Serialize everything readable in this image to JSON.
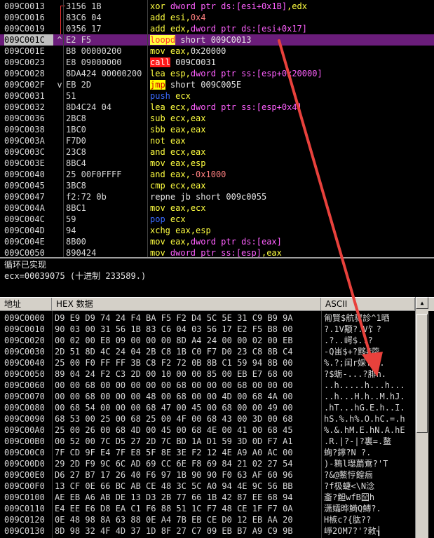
{
  "disasm": {
    "rows": [
      {
        "addr": "009C0013",
        "bytes": "3156 1B",
        "parts": [
          [
            "xor ",
            "kw"
          ],
          [
            "dword ptr ds:[esi+0x1B]",
            "mem"
          ],
          [
            ",edx",
            "kw"
          ]
        ]
      },
      {
        "addr": "009C0016",
        "bytes": "83C6 04",
        "parts": [
          [
            "add ",
            "kw"
          ],
          [
            "esi",
            "kw"
          ],
          [
            ",",
            "kw"
          ],
          [
            "0x4",
            "red"
          ]
        ]
      },
      {
        "addr": "009C0019",
        "bytes": "0356 17",
        "parts": [
          [
            "add ",
            "kw"
          ],
          [
            "edx",
            "kw"
          ],
          [
            ",",
            "kw"
          ],
          [
            "dword ptr ds:[esi+0x17]",
            "mem"
          ]
        ]
      },
      {
        "addr": "009C001C",
        "bytes": "E2 F5",
        "mark": "^",
        "selected": true,
        "parts": [
          [
            "loopd",
            "loop"
          ],
          [
            " short 009C0013",
            "plain"
          ]
        ]
      },
      {
        "addr": "009C001E",
        "bytes": "B8 00000200",
        "parts": [
          [
            "mov ",
            "kw"
          ],
          [
            "eax",
            "kw"
          ],
          [
            ",",
            "kw"
          ],
          [
            "0x20000",
            "plain"
          ]
        ]
      },
      {
        "addr": "009C0023",
        "bytes": "E8 09000000",
        "parts": [
          [
            "call",
            "call"
          ],
          [
            " 009C0031",
            "plain"
          ]
        ]
      },
      {
        "addr": "009C0028",
        "bytes": "8DA424 00000200",
        "parts": [
          [
            "lea ",
            "kw"
          ],
          [
            "esp",
            "kw"
          ],
          [
            ",",
            "kw"
          ],
          [
            "dword ptr ss:[esp+0x20000]",
            "mem"
          ]
        ]
      },
      {
        "addr": "009C002F",
        "bytes": "EB 2D",
        "mark": "v",
        "parts": [
          [
            "jmp",
            "jmp"
          ],
          [
            " short 009C005E",
            "plain"
          ]
        ]
      },
      {
        "addr": "009C0031",
        "bytes": "51",
        "parts": [
          [
            "push ",
            "blue"
          ],
          [
            "ecx",
            "kw"
          ]
        ]
      },
      {
        "addr": "009C0032",
        "bytes": "8D4C24 04",
        "parts": [
          [
            "lea ",
            "kw"
          ],
          [
            "ecx",
            "kw"
          ],
          [
            ",",
            "kw"
          ],
          [
            "dword ptr ss:[esp+0x4]",
            "mem"
          ]
        ]
      },
      {
        "addr": "009C0036",
        "bytes": "2BC8",
        "parts": [
          [
            "sub ",
            "kw"
          ],
          [
            "ecx",
            "kw"
          ],
          [
            ",",
            "kw"
          ],
          [
            "eax",
            "kw"
          ]
        ]
      },
      {
        "addr": "009C0038",
        "bytes": "1BC0",
        "parts": [
          [
            "sbb ",
            "kw"
          ],
          [
            "eax",
            "kw"
          ],
          [
            ",",
            "kw"
          ],
          [
            "eax",
            "kw"
          ]
        ]
      },
      {
        "addr": "009C003A",
        "bytes": "F7D0",
        "parts": [
          [
            "not ",
            "kw"
          ],
          [
            "eax",
            "kw"
          ]
        ]
      },
      {
        "addr": "009C003C",
        "bytes": "23C8",
        "parts": [
          [
            "and ",
            "kw"
          ],
          [
            "ecx",
            "kw"
          ],
          [
            ",",
            "kw"
          ],
          [
            "eax",
            "kw"
          ]
        ]
      },
      {
        "addr": "009C003E",
        "bytes": "8BC4",
        "parts": [
          [
            "mov ",
            "kw"
          ],
          [
            "eax",
            "kw"
          ],
          [
            ",",
            "kw"
          ],
          [
            "esp",
            "kw"
          ]
        ]
      },
      {
        "addr": "009C0040",
        "bytes": "25 00F0FFFF",
        "parts": [
          [
            "and ",
            "kw"
          ],
          [
            "eax",
            "kw"
          ],
          [
            ",",
            "kw"
          ],
          [
            "-0x1000",
            "red"
          ]
        ]
      },
      {
        "addr": "009C0045",
        "bytes": "3BC8",
        "parts": [
          [
            "cmp ",
            "kw"
          ],
          [
            "ecx",
            "kw"
          ],
          [
            ",",
            "kw"
          ],
          [
            "eax",
            "kw"
          ]
        ]
      },
      {
        "addr": "009C0047",
        "bytes": "f2:72 0b",
        "parts": [
          [
            "repne jb short 009c0055",
            "plain"
          ]
        ]
      },
      {
        "addr": "009C004A",
        "bytes": "8BC1",
        "parts": [
          [
            "mov ",
            "kw"
          ],
          [
            "eax",
            "kw"
          ],
          [
            ",",
            "kw"
          ],
          [
            "ecx",
            "kw"
          ]
        ]
      },
      {
        "addr": "009C004C",
        "bytes": "59",
        "parts": [
          [
            "pop ",
            "blue"
          ],
          [
            "ecx",
            "kw"
          ]
        ]
      },
      {
        "addr": "009C004D",
        "bytes": "94",
        "parts": [
          [
            "xchg ",
            "kw"
          ],
          [
            "eax",
            "kw"
          ],
          [
            ",",
            "kw"
          ],
          [
            "esp",
            "kw"
          ]
        ]
      },
      {
        "addr": "009C004E",
        "bytes": "8B00",
        "parts": [
          [
            "mov ",
            "kw"
          ],
          [
            "eax",
            "kw"
          ],
          [
            ",",
            "kw"
          ],
          [
            "dword ptr ds:[eax]",
            "mem"
          ]
        ]
      },
      {
        "addr": "009C0050",
        "bytes": "890424",
        "parts": [
          [
            "mov ",
            "kw"
          ],
          [
            "dword ptr ss:[esp]",
            "mem"
          ],
          [
            ",",
            "kw"
          ],
          [
            "eax",
            "kw"
          ]
        ]
      }
    ]
  },
  "info": {
    "line1": "循环已实现",
    "line2": "ecx=00039075 (十进制 233589.)"
  },
  "dump": {
    "header": {
      "addr": "地址",
      "hex": "HEX 数据",
      "ascii": "ASCII"
    },
    "rows": [
      {
        "addr": "009C0000",
        "hex": "D9 E9 D9 74 24 F4 BA F5 F2 D4 5C 5E 31 C9 B9 9A",
        "ascii": "匍賢$航骤診^1晒"
      },
      {
        "addr": "009C0010",
        "hex": "90 03 00 31 56 1B 83 C6 04 03 56 17 E2 F5 B8 00",
        "ascii": "?.1V颙?.V饣?"
      },
      {
        "addr": "009C0020",
        "hex": "00 02 00 E8 09 00 00 00 8D A4 24 00 00 02 00 EB",
        "ascii": ".?..崿$..?"
      },
      {
        "addr": "009C0030",
        "hex": "2D 51 8D 4C 24 04 2B C8 1B C0 F7 D0 23 C8 8B C4",
        "ascii": "-Q峀$+?黟#葖"
      },
      {
        "addr": "009C0040",
        "hex": "25 00 F0 FF FF 3B C8 F2 72 0B 8B C1 59 94 8B 00",
        "ascii": "%.?;闰r婇Y攱."
      },
      {
        "addr": "009C0050",
        "hex": "89 04 24 F2 C3 2D 00 10 00 00 85 00 EB E7 68 00",
        "ascii": "?$蛎-...?腓h."
      },
      {
        "addr": "009C0060",
        "hex": "00 00 68 00 00 00 00 00 68 00 00 00 68 00 00 00",
        "ascii": "..h.....h...h..."
      },
      {
        "addr": "009C0070",
        "hex": "00 00 68 00 00 00 48 00 68 00 00 4D 00 68 4A 00",
        "ascii": "..h...H.h..M.hJ."
      },
      {
        "addr": "009C0080",
        "hex": "00 68 54 00 00 00 68 47 00 45 00 68 00 00 49 00",
        "ascii": ".hT...hG.E.h..I."
      },
      {
        "addr": "009C0090",
        "hex": "68 53 00 25 00 68 25 00 4F 00 68 43 00 3D 00 68",
        "ascii": "hS.%.h%.O.hC.=.h"
      },
      {
        "addr": "009C00A0",
        "hex": "25 00 26 00 68 4D 00 45 00 68 4E 00 41 00 68 45",
        "ascii": "%.&.hM.E.hN.A.hE"
      },
      {
        "addr": "009C00B0",
        "hex": "00 52 00 7C D5 27 2D 7C BD 1A D1 59 3D 0D F7 A1",
        "ascii": ".R.|?-|?裏=.鳌"
      },
      {
        "addr": "009C00C0",
        "hex": "7F CD 9F E4 7F E8 5F 8E 3E F2 12 4E A9 A0 AC 00",
        "ascii": "蜔?鑏?N ?."
      },
      {
        "addr": "009C00D0",
        "hex": "29 2D F9 9C 6C AD 69 CC 6E F8 69 84 21 02 27 54",
        "ascii": ")-鶜l璱蘮鴌?'T"
      },
      {
        "addr": "009C00E0",
        "hex": "D6 27 B7 17 26 40 F6 97 1B 90 90 F0 63 AF 60 96",
        "ascii": "?&@鰲悙餭痐"
      },
      {
        "addr": "009C00F0",
        "hex": "13 CF 0E 66 BC AB CE 48 3C 5C A0 94 4E 9C 56 BB",
        "ascii": "?f极蜨<\\N淰"
      },
      {
        "addr": "009C0100",
        "hex": "AE EB A6 AB DE 13 D3 2B 77 66 1B 42 87 EE 68 94",
        "ascii": "齑?觛wfB囶h"
      },
      {
        "addr": "009C0110",
        "hex": "E4 EE E6 D8 EA C1 F6 88 51 1C F7 48 CE 1F F7 0A",
        "ascii": "潇孀晔鰣Q鱄?."
      },
      {
        "addr": "009C0120",
        "hex": "0E 48 98 8A 63 88 0E A4 7B EB CE D0 12 EB AA 20",
        "ascii": "H槉c?{肱??"
      },
      {
        "addr": "009C0130",
        "hex": "8D 98 32 4F 4D 37 1D 8F 27 C7 09 EB B7 A9 C9 9B",
        "ascii": "崢2OM7?'?敕┧"
      }
    ]
  }
}
